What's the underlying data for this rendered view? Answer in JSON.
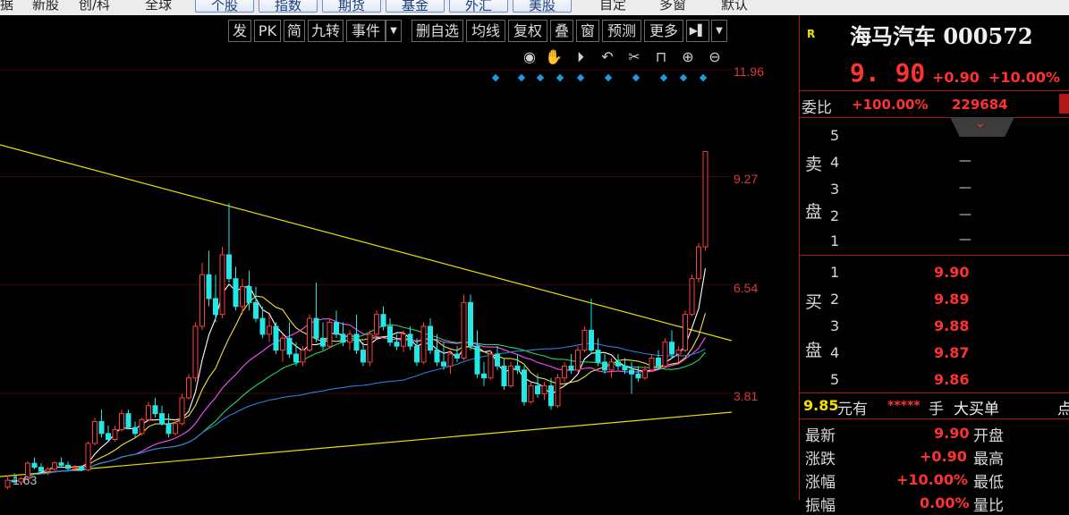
{
  "topbar": {
    "items": [
      "据",
      "新股",
      "创/科",
      "全球",
      "自定",
      "多窗",
      "默认"
    ],
    "buttons": [
      "个股",
      "指数",
      "期货",
      "基金",
      "外汇",
      "美股"
    ]
  },
  "toolbar": {
    "buttons": [
      "发",
      "PK",
      "简",
      "九转",
      "事件",
      "删自选",
      "均线",
      "复权",
      "叠",
      "窗",
      "预测",
      "更多"
    ],
    "event_dropdown": "▼",
    "more_dropdown": "▼",
    "side_icon": "▶▌"
  },
  "chart_controls": [
    "eye-icon",
    "hand-icon",
    "play-icon",
    "undo-icon",
    "scissors-icon",
    "lock-icon",
    "zoom-in-icon",
    "zoom-out-icon"
  ],
  "chart_data": {
    "type": "candlestick",
    "y_ticks": [
      "11.96",
      "9.27",
      "6.54",
      "3.81"
    ],
    "low_label": "1.63",
    "colors": {
      "up": "#ff3c3c",
      "down": "#23e6e6",
      "ma5": "#ffffff",
      "ma10": "#f0e040",
      "ma20": "#ff4cff",
      "ma30": "#2dd26a",
      "ma60": "#2e7de0",
      "trend": "#e8e000"
    },
    "candles": [
      [
        1.45,
        1.75,
        1.4,
        1.62
      ],
      [
        1.62,
        1.8,
        1.55,
        1.58
      ],
      [
        1.58,
        1.7,
        1.5,
        1.66
      ],
      [
        1.66,
        2.1,
        1.62,
        2.05
      ],
      [
        2.05,
        2.2,
        1.9,
        1.95
      ],
      [
        1.95,
        2.05,
        1.8,
        1.85
      ],
      [
        1.85,
        1.95,
        1.75,
        1.9
      ],
      [
        1.9,
        2.1,
        1.85,
        2.06
      ],
      [
        2.06,
        2.2,
        1.95,
        2.0
      ],
      [
        2.0,
        2.1,
        1.88,
        1.92
      ],
      [
        1.92,
        2.0,
        1.85,
        1.95
      ],
      [
        1.95,
        2.0,
        1.85,
        1.88
      ],
      [
        1.88,
        2.6,
        1.85,
        2.55
      ],
      [
        2.55,
        3.2,
        2.5,
        3.1
      ],
      [
        3.1,
        3.4,
        2.7,
        2.8
      ],
      [
        2.8,
        3.0,
        2.6,
        2.65
      ],
      [
        2.65,
        3.0,
        2.6,
        2.9
      ],
      [
        2.9,
        3.4,
        2.85,
        3.3
      ],
      [
        3.3,
        3.4,
        2.9,
        2.95
      ],
      [
        2.95,
        3.1,
        2.7,
        2.8
      ],
      [
        2.8,
        3.2,
        2.75,
        3.15
      ],
      [
        3.15,
        3.6,
        3.1,
        3.5
      ],
      [
        3.5,
        3.7,
        3.2,
        3.3
      ],
      [
        3.3,
        3.5,
        3.0,
        3.05
      ],
      [
        3.05,
        3.3,
        2.7,
        2.8
      ],
      [
        2.8,
        3.1,
        2.75,
        3.05
      ],
      [
        3.05,
        3.8,
        3.0,
        3.7
      ],
      [
        3.7,
        4.3,
        3.65,
        4.2
      ],
      [
        4.2,
        5.6,
        4.1,
        5.5
      ],
      [
        5.5,
        7.1,
        5.4,
        6.8
      ],
      [
        6.8,
        7.4,
        6.0,
        6.2
      ],
      [
        6.2,
        6.8,
        5.6,
        5.8
      ],
      [
        5.8,
        7.5,
        5.7,
        7.3
      ],
      [
        7.3,
        8.6,
        6.6,
        6.7
      ],
      [
        6.7,
        7.0,
        5.9,
        6.0
      ],
      [
        6.0,
        6.7,
        5.8,
        6.5
      ],
      [
        6.5,
        6.9,
        5.9,
        6.1
      ],
      [
        6.1,
        6.5,
        5.6,
        5.7
      ],
      [
        5.7,
        6.0,
        5.2,
        5.3
      ],
      [
        5.3,
        5.8,
        5.1,
        5.5
      ],
      [
        5.5,
        5.6,
        4.8,
        4.9
      ],
      [
        4.9,
        5.3,
        4.6,
        5.2
      ],
      [
        5.2,
        5.6,
        4.7,
        4.8
      ],
      [
        4.8,
        5.1,
        4.5,
        4.6
      ],
      [
        4.6,
        5.0,
        4.5,
        4.9
      ],
      [
        4.9,
        5.8,
        4.85,
        5.7
      ],
      [
        5.7,
        6.6,
        5.1,
        5.2
      ],
      [
        5.2,
        5.6,
        4.9,
        5.0
      ],
      [
        5.0,
        5.7,
        4.95,
        5.6
      ],
      [
        5.6,
        5.9,
        5.2,
        5.3
      ],
      [
        5.3,
        5.6,
        5.0,
        5.1
      ],
      [
        5.1,
        5.4,
        4.9,
        5.3
      ],
      [
        5.3,
        5.8,
        4.8,
        4.9
      ],
      [
        4.9,
        5.1,
        4.5,
        4.6
      ],
      [
        4.6,
        5.4,
        4.5,
        5.3
      ],
      [
        5.3,
        5.9,
        5.25,
        5.8
      ],
      [
        5.8,
        6.0,
        5.4,
        5.5
      ],
      [
        5.5,
        5.7,
        5.0,
        5.1
      ],
      [
        5.1,
        5.3,
        4.9,
        5.0
      ],
      [
        5.0,
        5.4,
        4.85,
        5.3
      ],
      [
        5.3,
        5.5,
        4.9,
        5.0
      ],
      [
        5.0,
        5.2,
        4.5,
        4.6
      ],
      [
        4.6,
        5.6,
        4.55,
        5.5
      ],
      [
        5.5,
        5.7,
        4.8,
        4.9
      ],
      [
        4.9,
        5.3,
        4.5,
        4.6
      ],
      [
        4.6,
        5.1,
        4.4,
        4.5
      ],
      [
        4.5,
        4.9,
        4.3,
        4.8
      ],
      [
        4.8,
        5.0,
        4.6,
        4.7
      ],
      [
        4.7,
        6.3,
        4.65,
        6.1
      ],
      [
        6.1,
        6.3,
        4.9,
        5.0
      ],
      [
        5.0,
        5.4,
        4.2,
        4.3
      ],
      [
        4.3,
        4.6,
        4.0,
        4.2
      ],
      [
        4.2,
        4.9,
        4.15,
        4.8
      ],
      [
        4.8,
        5.0,
        4.4,
        4.5
      ],
      [
        4.5,
        4.7,
        3.9,
        4.0
      ],
      [
        4.0,
        4.6,
        3.95,
        4.5
      ],
      [
        4.5,
        4.8,
        4.3,
        4.4
      ],
      [
        4.4,
        4.5,
        3.5,
        3.6
      ],
      [
        3.6,
        4.1,
        3.55,
        4.0
      ],
      [
        4.0,
        4.3,
        3.7,
        3.8
      ],
      [
        3.8,
        4.1,
        3.65,
        4.0
      ],
      [
        4.0,
        4.2,
        3.4,
        3.5
      ],
      [
        3.5,
        4.3,
        3.45,
        4.2
      ],
      [
        4.2,
        4.6,
        4.1,
        4.5
      ],
      [
        4.5,
        4.8,
        4.3,
        4.4
      ],
      [
        4.4,
        5.0,
        4.35,
        4.9
      ],
      [
        4.9,
        5.5,
        4.85,
        5.4
      ],
      [
        5.4,
        6.2,
        4.8,
        4.9
      ],
      [
        4.9,
        5.2,
        4.5,
        4.6
      ],
      [
        4.6,
        4.8,
        4.3,
        4.4
      ],
      [
        4.4,
        4.7,
        4.2,
        4.6
      ],
      [
        4.6,
        4.8,
        4.4,
        4.5
      ],
      [
        4.5,
        4.7,
        4.3,
        4.4
      ],
      [
        4.4,
        4.6,
        3.8,
        4.3
      ],
      [
        4.3,
        4.5,
        4.1,
        4.2
      ],
      [
        4.2,
        4.5,
        4.15,
        4.4
      ],
      [
        4.4,
        4.8,
        4.35,
        4.7
      ],
      [
        4.7,
        4.9,
        4.4,
        4.5
      ],
      [
        4.5,
        5.2,
        4.45,
        5.1
      ],
      [
        5.1,
        5.4,
        4.7,
        4.8
      ],
      [
        4.8,
        5.0,
        4.6,
        4.9
      ],
      [
        4.9,
        5.9,
        4.85,
        5.8
      ],
      [
        5.8,
        6.8,
        5.75,
        6.7
      ],
      [
        6.7,
        7.6,
        6.6,
        7.5
      ],
      [
        7.5,
        9.9,
        7.4,
        9.9
      ]
    ]
  },
  "quote": {
    "r_badge": "R",
    "name": "海马汽车 000572",
    "price": "9. 90",
    "change": "+0.90",
    "change_pct": "+10.00%",
    "weibi_label": "委比",
    "weibi_pct": "+100.00%",
    "weibi_val": "229684",
    "sell_label_1": "卖",
    "sell_label_2": "盘",
    "buy_label_1": "买",
    "buy_label_2": "盘",
    "asks": [
      {
        "level": "5",
        "price": ""
      },
      {
        "level": "4",
        "price": "—"
      },
      {
        "level": "3",
        "price": "—"
      },
      {
        "level": "2",
        "price": "—"
      },
      {
        "level": "1",
        "price": "—"
      }
    ],
    "bids": [
      {
        "level": "1",
        "price": "9.90"
      },
      {
        "level": "2",
        "price": "9.89"
      },
      {
        "level": "3",
        "price": "9.88"
      },
      {
        "level": "4",
        "price": "9.87"
      },
      {
        "level": "5",
        "price": "9.86"
      }
    ],
    "bigorder": {
      "price": "9.85",
      "unit": "元有",
      "qty": "*****",
      "hand": "手",
      "label": "大买单",
      "tail": "点"
    },
    "stats": [
      {
        "label": "最新",
        "value": "9.90",
        "label2": "开盘"
      },
      {
        "label": "涨跌",
        "value": "+0.90",
        "label2": "最高"
      },
      {
        "label": "涨幅",
        "value": "+10.00%",
        "label2": "最低"
      },
      {
        "label": "振幅",
        "value": "0.00%",
        "label2": "量比"
      }
    ]
  }
}
